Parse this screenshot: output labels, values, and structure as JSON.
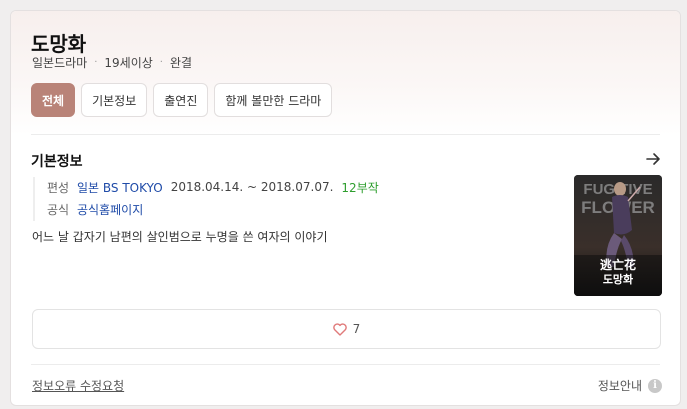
{
  "title": "도망화",
  "meta": {
    "genre": "일본드라마",
    "rating": "19세이상",
    "status": "완결"
  },
  "tabs": [
    {
      "label": "전체",
      "active": true
    },
    {
      "label": "기본정보",
      "active": false
    },
    {
      "label": "출연진",
      "active": false
    },
    {
      "label": "함께 볼만한 드라마",
      "active": false
    }
  ],
  "section": {
    "title": "기본정보",
    "arrow_icon": "arrow-right-icon"
  },
  "info": {
    "schedule_key": "편성",
    "broadcaster": "일본 BS TOKYO",
    "period": "2018.04.14. ~ 2018.07.07.",
    "episodes": "12부작",
    "official_key": "공식",
    "official_link": "공식홈페이지"
  },
  "description": "어느 날 갑자기 남편의 살인범으로 누명을 쓴 여자의 이야기",
  "poster": {
    "title_en_line1": "FUGITIVE",
    "title_en_line2": "FLOWER",
    "title_cjk": "逃亡花",
    "title_ko": "도망화"
  },
  "like": {
    "icon": "heart-icon",
    "count": "7"
  },
  "footer": {
    "report_link": "정보오류 수정요청",
    "guide_label": "정보안내",
    "guide_icon": "i"
  },
  "colors": {
    "active_tab": "#b98378",
    "link": "#1f4ba8",
    "episodes": "#2e9e2e",
    "heart": "#e07a7a"
  }
}
